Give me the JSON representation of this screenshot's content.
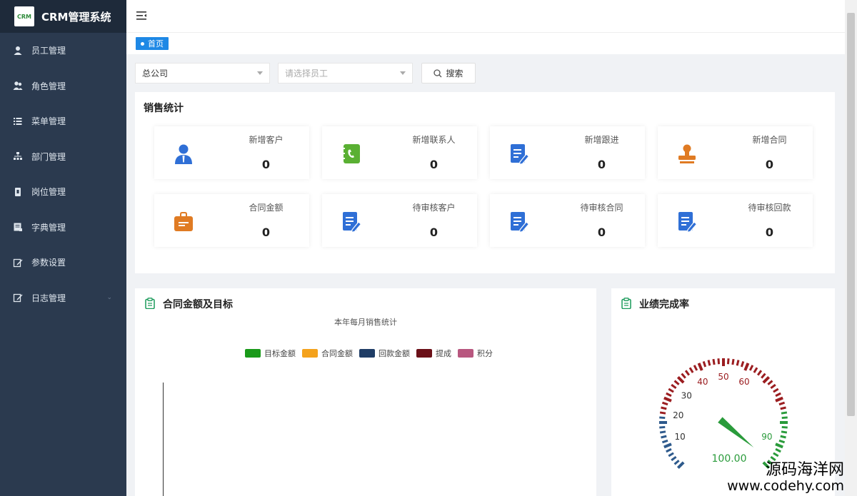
{
  "app": {
    "title": "CRM管理系统",
    "logo_text": "CRM"
  },
  "sidebar": {
    "items": [
      {
        "label": "员工管理",
        "icon": "user-icon"
      },
      {
        "label": "角色管理",
        "icon": "users-icon"
      },
      {
        "label": "菜单管理",
        "icon": "list-icon"
      },
      {
        "label": "部门管理",
        "icon": "sitemap-icon"
      },
      {
        "label": "岗位管理",
        "icon": "id-card-icon"
      },
      {
        "label": "字典管理",
        "icon": "book-icon"
      },
      {
        "label": "参数设置",
        "icon": "edit-icon"
      },
      {
        "label": "日志管理",
        "icon": "log-icon",
        "has_submenu": true
      }
    ]
  },
  "tabs": [
    {
      "label": "首页"
    }
  ],
  "filters": {
    "company": {
      "value": "总公司"
    },
    "employee": {
      "placeholder": "请选择员工"
    },
    "search_label": "搜索"
  },
  "sales": {
    "title": "销售统计",
    "cards": [
      {
        "label": "新增客户",
        "value": "0",
        "icon": "customer-icon",
        "color": "#2f6fd6"
      },
      {
        "label": "新增联系人",
        "value": "0",
        "icon": "contact-book-icon",
        "color": "#5ab033"
      },
      {
        "label": "新增跟进",
        "value": "0",
        "icon": "document-edit-icon",
        "color": "#2f6fd6"
      },
      {
        "label": "新增合同",
        "value": "0",
        "icon": "stamp-icon",
        "color": "#e07b23"
      },
      {
        "label": "合同金额",
        "value": "0",
        "icon": "briefcase-icon",
        "color": "#e07b23"
      },
      {
        "label": "待审核客户",
        "value": "0",
        "icon": "document-edit-icon",
        "color": "#2f6fd6"
      },
      {
        "label": "待审核合同",
        "value": "0",
        "icon": "document-edit-icon",
        "color": "#2f6fd6"
      },
      {
        "label": "待审核回款",
        "value": "0",
        "icon": "document-edit-icon",
        "color": "#2f6fd6"
      }
    ]
  },
  "contract_chart": {
    "title": "合同金额及目标",
    "subtitle": "本年每月销售统计",
    "legend": [
      {
        "name": "目标金额",
        "color": "#1a9a1a"
      },
      {
        "name": "合同金额",
        "color": "#f4a21c"
      },
      {
        "name": "回款金额",
        "color": "#1f3d66"
      },
      {
        "name": "提成",
        "color": "#6b1018"
      },
      {
        "name": "积分",
        "color": "#b8577f"
      }
    ]
  },
  "gauge": {
    "title": "业绩完成率",
    "ticks": [
      "10",
      "20",
      "30",
      "40",
      "50",
      "60",
      "90"
    ],
    "detail": "100.00"
  },
  "watermark": {
    "line1": "源码海洋网",
    "line2": "www.codehy.com"
  }
}
